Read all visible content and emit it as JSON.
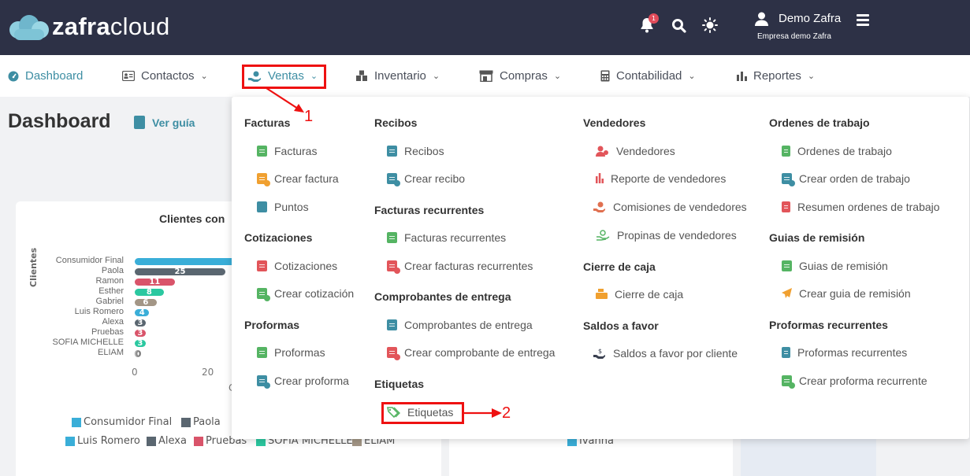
{
  "header": {
    "logo_bold": "zafra",
    "logo_light": "cloud",
    "notification_count": "1",
    "user_name": "Demo Zafra",
    "company": "Empresa demo Zafra",
    "icons": [
      "bell-icon",
      "search-icon",
      "sun-icon",
      "user-icon",
      "hamburger-icon"
    ]
  },
  "nav": {
    "items": [
      {
        "label": "Dashboard",
        "icon": "gauge-icon"
      },
      {
        "label": "Contactos",
        "icon": "contact-card-icon"
      },
      {
        "label": "Ventas",
        "icon": "hand-coin-icon"
      },
      {
        "label": "Inventario",
        "icon": "boxes-icon"
      },
      {
        "label": "Compras",
        "icon": "store-icon"
      },
      {
        "label": "Contabilidad",
        "icon": "calculator-icon"
      },
      {
        "label": "Reportes",
        "icon": "bar-chart-icon"
      }
    ]
  },
  "page": {
    "title": "Dashboard",
    "guide_label": "Ver guía"
  },
  "chart_data": {
    "type": "bar",
    "title": "Clientes con",
    "ylabel": "Clientes",
    "categories": [
      "Consumidor Final",
      "Paola",
      "Ramon",
      "Esther",
      "Gabriel",
      "Luis Romero",
      "Alexa",
      "Pruebas",
      "SOFIA MICHELLE",
      "ELIAM"
    ],
    "values": [
      null,
      25,
      11,
      8,
      6,
      4,
      3,
      3,
      3,
      0
    ],
    "data_labels": [
      "",
      "25",
      "11",
      "8",
      "6",
      "4",
      "3",
      "3",
      "3",
      "0"
    ],
    "xticks": [
      "0",
      "20"
    ],
    "colors": [
      "#3aaed8",
      "#5a6670",
      "#d9546a",
      "#2bc8a0",
      "#a39686",
      "#3aaed8",
      "#5a6670",
      "#d9546a",
      "#2bc8a0",
      "#a39686"
    ],
    "legend": [
      {
        "name": "Consumidor Final",
        "color": "#3aaed8"
      },
      {
        "name": "Paola",
        "color": "#5a6670"
      },
      {
        "name": "Luis Romero",
        "color": "#3aaed8"
      },
      {
        "name": "Alexa",
        "color": "#5a6670"
      },
      {
        "name": "Pruebas",
        "color": "#d9546a"
      },
      {
        "name": "SOFIA MICHELLE",
        "color": "#2bc8a0"
      },
      {
        "name": "ELIAM",
        "color": "#a39686"
      }
    ],
    "xlabel_partial": "C"
  },
  "second_card_legend": {
    "name": "Ivanna",
    "color": "#3aaed8"
  },
  "menu": {
    "facturas_title": "Facturas",
    "facturas": [
      "Facturas",
      "Crear factura",
      "Puntos"
    ],
    "cotizaciones_title": "Cotizaciones",
    "cotizaciones": [
      "Cotizaciones",
      "Crear cotización"
    ],
    "proformas_title": "Proformas",
    "proformas": [
      "Proformas",
      "Crear proforma"
    ],
    "recibos_title": "Recibos",
    "recibos": [
      "Recibos",
      "Crear recibo"
    ],
    "recurrentes_title": "Facturas recurrentes",
    "recurrentes": [
      "Facturas recurrentes",
      "Crear facturas recurrentes"
    ],
    "comprobantes_title": "Comprobantes de entrega",
    "comprobantes": [
      "Comprobantes de entrega",
      "Crear comprobante de entrega"
    ],
    "etiquetas_title": "Etiquetas",
    "etiquetas": [
      "Etiquetas"
    ],
    "vendedores_title": "Vendedores",
    "vendedores": [
      "Vendedores",
      "Reporte de vendedores",
      "Comisiones de vendedores",
      "Propinas de vendedores"
    ],
    "cierre_title": "Cierre de caja",
    "cierre": [
      "Cierre de caja"
    ],
    "saldos_title": "Saldos a favor",
    "saldos": [
      "Saldos a favor por cliente"
    ],
    "ordenes_title": "Ordenes de trabajo",
    "ordenes": [
      "Ordenes de trabajo",
      "Crear orden de trabajo",
      "Resumen ordenes de trabajo"
    ],
    "guias_title": "Guias de remisión",
    "guias": [
      "Guias de remisión",
      "Crear guia de remisión"
    ],
    "proformas_rec_title": "Proformas recurrentes",
    "proformas_rec": [
      "Proformas recurrentes",
      "Crear proforma recurrente"
    ]
  },
  "annotations": {
    "step1": "1",
    "step2": "2",
    "color": "#ee1111"
  },
  "colors": {
    "header_bg": "#2d3146",
    "accent": "#3e8ea3",
    "green": "#55b463",
    "orange": "#f0a030",
    "red": "#e2555a"
  }
}
